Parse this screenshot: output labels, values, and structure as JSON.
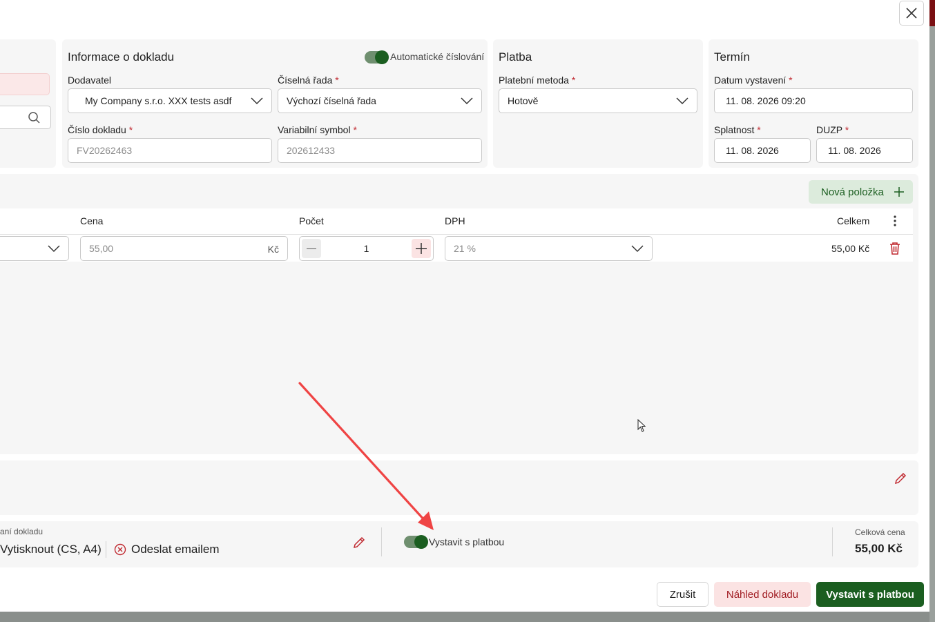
{
  "close_label": "×",
  "doc_info": {
    "title": "Informace o dokladu",
    "auto_numbering_label": "Automatické číslování",
    "supplier_label": "Dodavatel",
    "supplier_value": "My Company s.r.o. XXX tests asdf",
    "series_label": "Číselná řada",
    "series_value": "Výchozí číselná řada",
    "doc_number_label": "Číslo dokladu",
    "doc_number_value": "FV20262463",
    "var_symbol_label": "Variabilní symbol",
    "var_symbol_value": "202612433",
    "required_mark": "*"
  },
  "payment": {
    "title": "Platba",
    "method_label": "Platební metoda",
    "method_value": "Hotově"
  },
  "term": {
    "title": "Termín",
    "issue_label": "Datum vystavení",
    "issue_value": "11. 08. 2026 09:20",
    "due_label": "Splatnost",
    "due_value": "11. 08. 2026",
    "duzp_label": "DUZP",
    "duzp_value": "11. 08. 2026"
  },
  "items": {
    "new_item_label": "Nová položka",
    "columns": {
      "price": "Cena",
      "count": "Počet",
      "vat": "DPH",
      "total": "Celkem"
    },
    "row": {
      "price": "55,00",
      "currency": "Kč",
      "count": "1",
      "vat": "21 %",
      "total": "55,00 Kč"
    }
  },
  "footer": {
    "after_issue_label": "aní dokladu",
    "print_label": "Vytisknout (CS, A4)",
    "email_label": "Odeslat emailem",
    "issue_with_payment_toggle": "Vystavit s platbou",
    "total_label": "Celková cena",
    "total_value": "55,00 Kč"
  },
  "actions": {
    "cancel": "Zrušit",
    "preview": "Náhled dokladu",
    "issue": "Vystavit s platbou"
  },
  "colors": {
    "accent_green": "#1b5e20",
    "danger_red": "#c0282f",
    "annotation_arrow": "#ef4444"
  }
}
